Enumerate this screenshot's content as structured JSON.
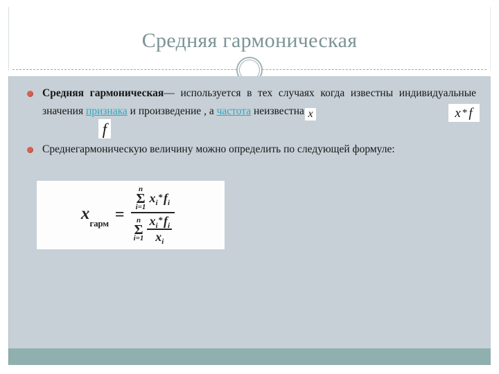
{
  "slide": {
    "title": "Средняя гармоническая",
    "theme": {
      "title_color": "#7d9396",
      "content_bg": "#c6d0d6",
      "bottom_band": "#8fb0ae",
      "bullet_color": "#d9604e",
      "hyperlink_color": "#2ba7c6",
      "text_color": "#161616"
    }
  },
  "bullets": [
    {
      "lead_bold": "Средняя гармоническая",
      "dash": "—",
      "part1": " используется в тех случаях когда известны индивидуальные значения ",
      "link1": "признака",
      "part2": " и произведение",
      "comma": " , ",
      "part3": "а ",
      "link2": "частота",
      "part4": " неизвестна"
    },
    {
      "text": "Среднегармоническую величину можно определить по следующей формуле:"
    }
  ],
  "math_chips": [
    {
      "id": "math-x",
      "label": "x",
      "text": "x"
    },
    {
      "id": "math-f",
      "label": "f",
      "text": "f"
    },
    {
      "id": "math-xf",
      "label": "x-times-f",
      "lhs": "x",
      "op": "*",
      "rhs": "f"
    }
  ],
  "formula": {
    "lhs_var": "x",
    "lhs_sub": "гарм",
    "equals": "=",
    "numerator": {
      "sigma_sup": "n",
      "sigma": "Σ",
      "sigma_sub": "i=1",
      "term_x": "x",
      "term_x_idx": "i",
      "term_op": "*",
      "term_f": "f",
      "term_f_idx": "i"
    },
    "denominator": {
      "sigma_sup": "n",
      "sigma": "Σ",
      "sigma_sub": "i=1",
      "frac_num_x": "x",
      "frac_num_x_idx": "i",
      "frac_num_op": "*",
      "frac_num_f": "f",
      "frac_num_f_idx": "i",
      "frac_den_x": "x",
      "frac_den_x_idx": "i"
    }
  }
}
